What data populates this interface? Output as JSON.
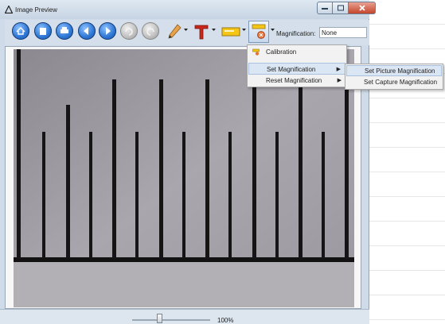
{
  "window": {
    "title": "Image Preview",
    "controls": {
      "minimize": "minimize",
      "maximize": "maximize",
      "close": "close"
    }
  },
  "toolbar": {
    "buttons": [
      {
        "name": "home",
        "icon": "home-icon"
      },
      {
        "name": "open",
        "icon": "open-icon"
      },
      {
        "name": "print",
        "icon": "print-icon"
      },
      {
        "name": "previous",
        "icon": "previous-icon"
      },
      {
        "name": "next",
        "icon": "next-icon"
      },
      {
        "name": "rotate-left",
        "icon": "rotate-left-icon"
      },
      {
        "name": "rotate-right",
        "icon": "rotate-right-icon"
      }
    ],
    "tools": [
      "pencil-icon",
      "text-icon",
      "highlight-icon",
      "measure-icon"
    ],
    "magnification_label": "Magnification:",
    "magnification_value": "None"
  },
  "menu": {
    "items": [
      {
        "label": "Calibration",
        "icon": "ruler-icon",
        "has_submenu": false
      },
      {
        "label": "Set Magnification",
        "has_submenu": true,
        "highlighted": true
      },
      {
        "label": "Reset Magnification",
        "has_submenu": true
      }
    ],
    "submenu": [
      {
        "label": "Set Picture Magnification",
        "highlighted": true
      },
      {
        "label": "Set Capture Magnification"
      }
    ]
  },
  "statusbar": {
    "zoom_level": 0.35,
    "zoom_text": "100%"
  },
  "colors": {
    "accent": "#2f78d6",
    "menu_highlight": "#dbe6f4",
    "frame": "#cfdbe8"
  }
}
